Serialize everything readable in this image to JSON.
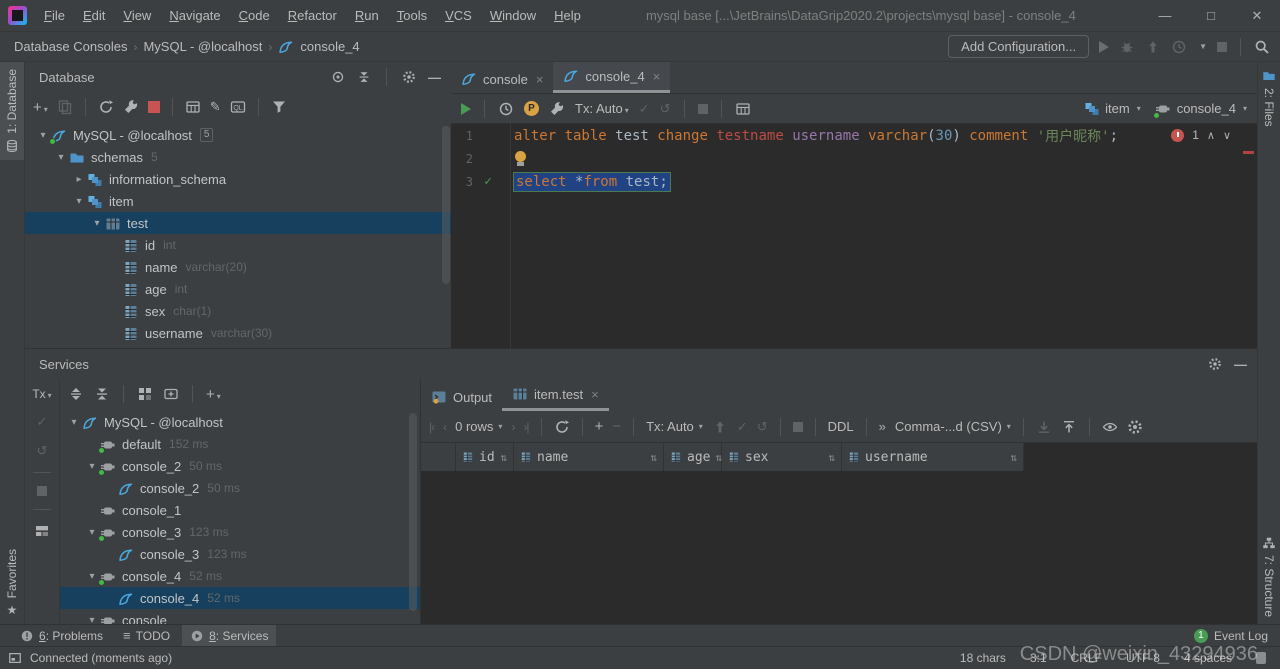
{
  "window": {
    "title": "mysql base [...\\JetBrains\\DataGrip2020.2\\projects\\mysql base] - console_4",
    "menu": [
      "File",
      "Edit",
      "View",
      "Navigate",
      "Code",
      "Refactor",
      "Run",
      "Tools",
      "VCS",
      "Window",
      "Help"
    ]
  },
  "breadcrumbs": {
    "items": [
      "Database Consoles",
      "MySQL - @localhost",
      "console_4"
    ],
    "add_configuration": "Add Configuration..."
  },
  "database_panel": {
    "title": "Database",
    "tree": [
      {
        "label": "MySQL - @localhost",
        "icon": "dolphin",
        "chev": "v",
        "badge": "5",
        "indent": 0,
        "dot": true
      },
      {
        "label": "schemas",
        "icon": "folder",
        "chev": "v",
        "suffix": "5",
        "indent": 1
      },
      {
        "label": "information_schema",
        "icon": "schema",
        "chev": ">",
        "indent": 2
      },
      {
        "label": "item",
        "icon": "schema",
        "chev": "v",
        "indent": 2
      },
      {
        "label": "test",
        "icon": "table",
        "chev": "v",
        "indent": 3,
        "selected": true
      },
      {
        "label": "id",
        "icon": "column",
        "suffix": "int",
        "indent": 4
      },
      {
        "label": "name",
        "icon": "column",
        "suffix": "varchar(20)",
        "indent": 4
      },
      {
        "label": "age",
        "icon": "column",
        "suffix": "int",
        "indent": 4
      },
      {
        "label": "sex",
        "icon": "column",
        "suffix": "char(1)",
        "indent": 4
      },
      {
        "label": "username",
        "icon": "column",
        "suffix": "varchar(30)",
        "indent": 4
      }
    ]
  },
  "editor": {
    "tabs": [
      {
        "label": "console",
        "active": false
      },
      {
        "label": "console_4",
        "active": true
      }
    ],
    "toolbar": {
      "tx": "Tx: Auto",
      "schema": "item",
      "console": "console_4"
    },
    "error_count": "1",
    "lines": [
      {
        "num": "1",
        "tokens": [
          {
            "t": "alter table",
            "c": "kw"
          },
          {
            "t": " test ",
            "c": "pl"
          },
          {
            "t": "change",
            "c": "kw"
          },
          {
            "t": " ",
            "c": "pl"
          },
          {
            "t": "testname",
            "c": "err"
          },
          {
            "t": " ",
            "c": "pl"
          },
          {
            "t": "username",
            "c": "var"
          },
          {
            "t": " ",
            "c": "pl"
          },
          {
            "t": "varchar",
            "c": "kw"
          },
          {
            "t": "(",
            "c": "pl"
          },
          {
            "t": "30",
            "c": "num"
          },
          {
            "t": ")",
            "c": "pl"
          },
          {
            "t": " ",
            "c": "pl"
          },
          {
            "t": "comment",
            "c": "kw"
          },
          {
            "t": " ",
            "c": "pl"
          },
          {
            "t": "'用户昵称'",
            "c": "str"
          },
          {
            "t": ";",
            "c": "pl"
          }
        ]
      },
      {
        "num": "2",
        "bulb": true,
        "tokens": []
      },
      {
        "num": "3",
        "check": true,
        "selected": true,
        "tokens": [
          {
            "t": "select ",
            "c": "kw"
          },
          {
            "t": "*",
            "c": "pl"
          },
          {
            "t": "from",
            "c": "kw"
          },
          {
            "t": " test",
            "c": "pl"
          },
          {
            "t": ";",
            "c": "pl"
          }
        ]
      }
    ]
  },
  "services_panel": {
    "title": "Services",
    "tx": "Tx",
    "tree": [
      {
        "label": "MySQL - @localhost",
        "icon": "dolphin",
        "chev": "v",
        "indent": 0
      },
      {
        "label": "default",
        "icon": "plug",
        "dot": true,
        "suffix": "152 ms",
        "indent": 1
      },
      {
        "label": "console_2",
        "icon": "plug",
        "dot": true,
        "chev": "v",
        "suffix": "50 ms",
        "indent": 1
      },
      {
        "label": "console_2",
        "icon": "dolphin",
        "suffix": "50 ms",
        "indent": 2
      },
      {
        "label": "console_1",
        "icon": "plug",
        "indent": 1
      },
      {
        "label": "console_3",
        "icon": "plug",
        "dot": true,
        "chev": "v",
        "suffix": "123 ms",
        "indent": 1
      },
      {
        "label": "console_3",
        "icon": "dolphin",
        "suffix": "123 ms",
        "indent": 2
      },
      {
        "label": "console_4",
        "icon": "plug",
        "dot": true,
        "chev": "v",
        "suffix": "52 ms",
        "indent": 1
      },
      {
        "label": "console_4",
        "icon": "dolphin",
        "suffix": "52 ms",
        "indent": 2,
        "selected": true
      },
      {
        "label": "console",
        "icon": "plug",
        "chev": "v",
        "indent": 1
      }
    ]
  },
  "output": {
    "tabs": [
      {
        "label": "Output",
        "icon": "outputtab",
        "active": false,
        "closable": false
      },
      {
        "label": "item.test",
        "icon": "table",
        "active": true,
        "closable": true
      }
    ],
    "toolbar": {
      "rows": "0 rows",
      "tx": "Tx: Auto",
      "ddl": "DDL",
      "format": "Comma-...d (CSV)"
    },
    "columns": [
      "id",
      "name",
      "age",
      "sex",
      "username"
    ]
  },
  "bottom_bar": {
    "items": [
      {
        "num": "6",
        "rest": ": Problems",
        "icon": "problem",
        "active": false
      },
      {
        "num": "",
        "rest": "TODO",
        "icon": "todo",
        "active": false
      },
      {
        "num": "8",
        "rest": ": Services",
        "icon": "playc",
        "active": true
      }
    ],
    "event_count": "1",
    "event_log": "Event Log"
  },
  "status_bar": {
    "left": "Connected (moments ago)",
    "right": [
      "18 chars",
      "3:1",
      "CRLF",
      "UTF-8",
      "4 spaces"
    ]
  },
  "stripes": {
    "left_top": "1: Database",
    "left_bottom": "Favorites",
    "right_top": "2: Files",
    "right_bottom": "7: Structure"
  },
  "watermark": "CSDN @weixin_43294936",
  "colors": {
    "panel_bg": "#3C3F41",
    "editor_bg": "#2B2B2B",
    "selection_editor": "#214283",
    "selection_tree": "#17405F",
    "error_red": "#C75450",
    "run_green": "#499C54",
    "keyword_orange": "#CC7832",
    "string_green": "#6A8759",
    "variable_purple": "#9876AA",
    "unresolved_red": "#BC4C44",
    "connected_dot": "#3FBA45",
    "accent_blue": "#4BA7DE"
  }
}
